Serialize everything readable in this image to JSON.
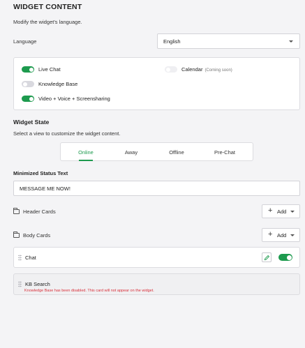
{
  "header": {
    "title": "WIDGET CONTENT",
    "subtitle": "Modify the widget's language."
  },
  "language": {
    "label": "Language",
    "selected": "English"
  },
  "features": [
    {
      "label": "Live Chat",
      "enabled": true
    },
    {
      "label": "Calendar",
      "note": "(Coming soon)",
      "enabled": false
    },
    {
      "label": "Knowledge Base",
      "enabled": false
    },
    {
      "label": "Video + Voice + Screensharing",
      "enabled": true
    }
  ],
  "widget_state": {
    "title": "Widget State",
    "subtitle": "Select a view to customize the widget content.",
    "tabs": [
      "Online",
      "Away",
      "Offline",
      "Pre-Chat"
    ],
    "active_tab": "Online"
  },
  "minimized": {
    "label": "Minimized Status Text",
    "value": "MESSAGE ME NOW!"
  },
  "header_cards": {
    "label": "Header Cards",
    "add_label": "Add"
  },
  "body_cards": {
    "label": "Body Cards",
    "add_label": "Add"
  },
  "cards": [
    {
      "label": "Chat",
      "enabled": true
    },
    {
      "label": "KB Search",
      "error": "Knowledge Base has been disabled. This card will not appear on the widget."
    }
  ],
  "colors": {
    "accent": "#1d9a4e",
    "error": "#d9303b"
  }
}
